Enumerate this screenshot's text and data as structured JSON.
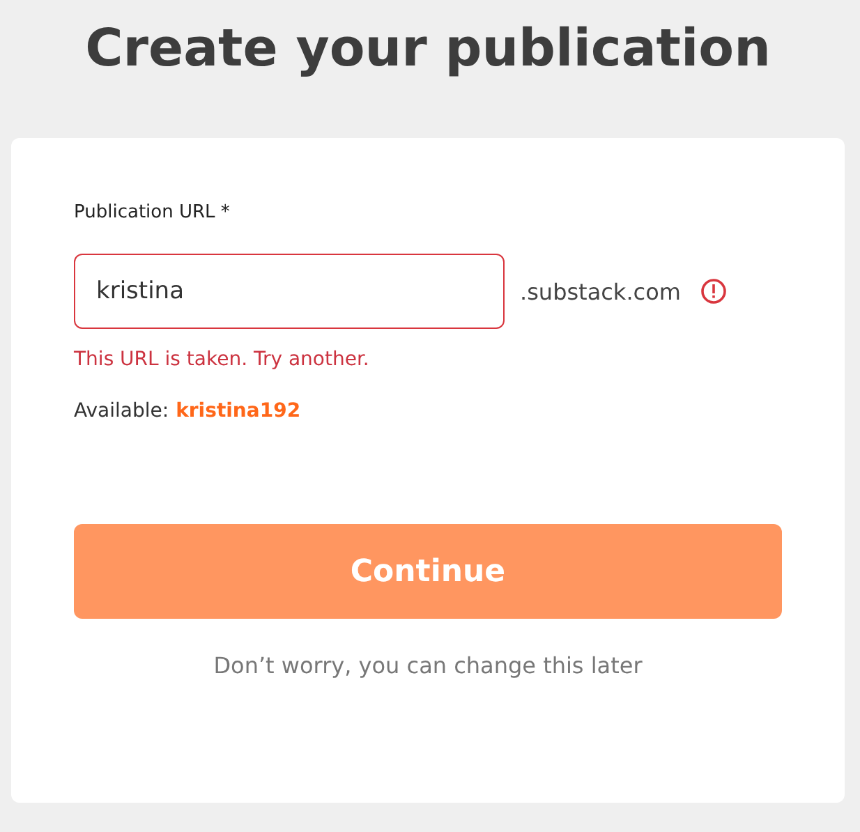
{
  "title": "Create your publication",
  "field": {
    "label": "Publication URL *",
    "value": "kristina",
    "suffix": ".substack.com",
    "error": true,
    "error_message": "This URL is taken. Try another."
  },
  "suggestion": {
    "label": "Available:",
    "value": "kristina192"
  },
  "button": "Continue",
  "note": "Don’t worry, you can change this later"
}
